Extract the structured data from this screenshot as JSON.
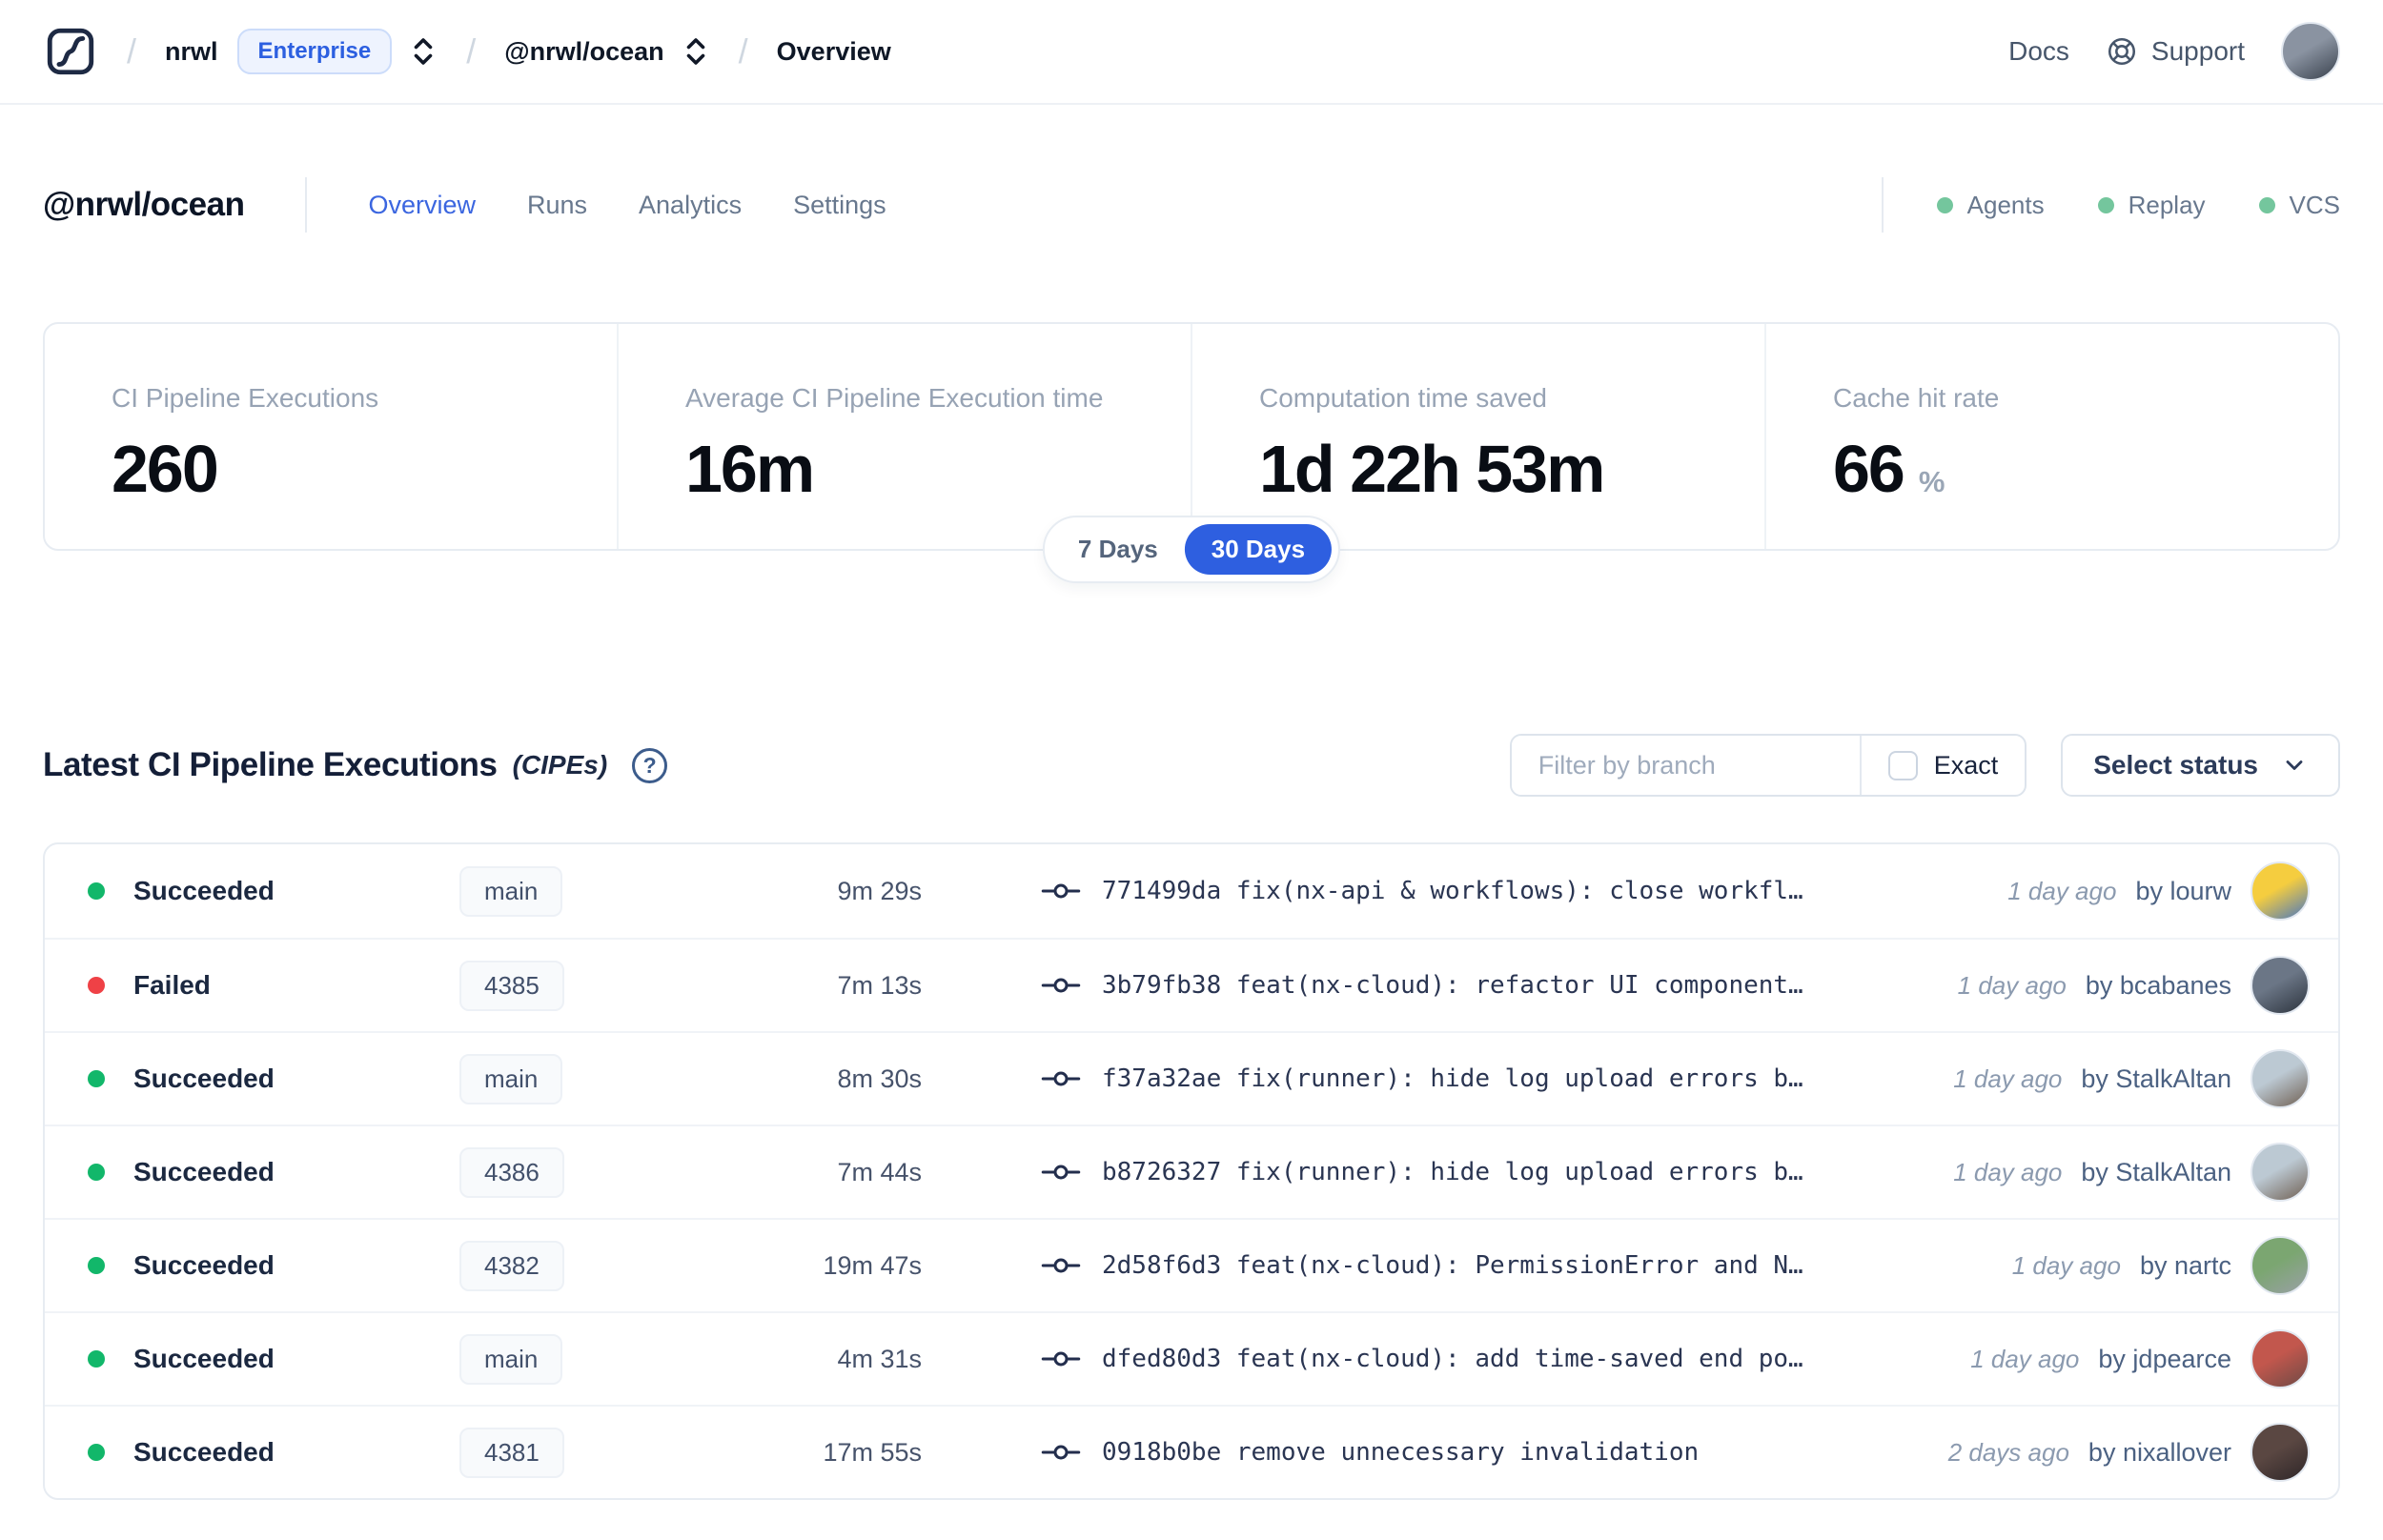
{
  "topbar": {
    "breadcrumb": {
      "org": "nrwl",
      "org_badge": "Enterprise",
      "workspace": "@nrwl/ocean",
      "page": "Overview"
    },
    "docs_label": "Docs",
    "support_label": "Support"
  },
  "workspace_header": {
    "title": "@nrwl/ocean",
    "tabs": [
      {
        "label": "Overview"
      },
      {
        "label": "Runs"
      },
      {
        "label": "Analytics"
      },
      {
        "label": "Settings"
      }
    ],
    "status_dot_color": "#74c69d",
    "statuses": [
      {
        "label": "Agents"
      },
      {
        "label": "Replay"
      },
      {
        "label": "VCS"
      }
    ]
  },
  "stats": {
    "cards": [
      {
        "label": "CI Pipeline Executions",
        "value": "260",
        "suffix": ""
      },
      {
        "label": "Average CI Pipeline Execution time",
        "value": "16m",
        "suffix": ""
      },
      {
        "label": "Computation time saved",
        "value": "1d 22h 53m",
        "suffix": ""
      },
      {
        "label": "Cache hit rate",
        "value": "66",
        "suffix": "%"
      }
    ],
    "range_toggle": {
      "options": [
        "7 Days",
        "30 Days"
      ],
      "selected": "30 Days"
    }
  },
  "cipe_section": {
    "title": "Latest CI Pipeline Executions",
    "title_suffix": "(CIPEs)",
    "help_glyph": "?",
    "filter": {
      "placeholder": "Filter by branch",
      "exact_label": "Exact"
    },
    "status_select_label": "Select status",
    "rows": [
      {
        "status": "Succeeded",
        "dot_color": "#12b76a",
        "branch": "main",
        "duration": "9m 29s",
        "commit_hash": "771499da",
        "commit_message": "fix(nx-api & workflows): close workfl…",
        "time": "1 day ago",
        "author": "by lourw",
        "avatar_colors": [
          "#f5cd3f",
          "#4a77c0"
        ]
      },
      {
        "status": "Failed",
        "dot_color": "#ef4146",
        "branch": "4385",
        "duration": "7m 13s",
        "commit_hash": "3b79fb38",
        "commit_message": "feat(nx-cloud): refactor UI component…",
        "time": "1 day ago",
        "author": "by bcabanes",
        "avatar_colors": [
          "#6b7686",
          "#2c333d"
        ]
      },
      {
        "status": "Succeeded",
        "dot_color": "#12b76a",
        "branch": "main",
        "duration": "8m 30s",
        "commit_hash": "f37a32ae",
        "commit_message": "fix(runner): hide log upload errors b…",
        "time": "1 day ago",
        "author": "by StalkAltan",
        "avatar_colors": [
          "#bcc9d3",
          "#6f5f52"
        ]
      },
      {
        "status": "Succeeded",
        "dot_color": "#12b76a",
        "branch": "4386",
        "duration": "7m 44s",
        "commit_hash": "b8726327",
        "commit_message": "fix(runner): hide log upload errors b…",
        "time": "1 day ago",
        "author": "by StalkAltan",
        "avatar_colors": [
          "#bcc9d3",
          "#6f5f52"
        ]
      },
      {
        "status": "Succeeded",
        "dot_color": "#12b76a",
        "branch": "4382",
        "duration": "19m 47s",
        "commit_hash": "2d58f6d3",
        "commit_message": "feat(nx-cloud): PermissionError and N…",
        "time": "1 day ago",
        "author": "by nartc",
        "avatar_colors": [
          "#7ba671",
          "#9aa0a6"
        ]
      },
      {
        "status": "Succeeded",
        "dot_color": "#12b76a",
        "branch": "main",
        "duration": "4m 31s",
        "commit_hash": "dfed80d3",
        "commit_message": "feat(nx-cloud): add time-saved end po…",
        "time": "1 day ago",
        "author": "by jdpearce",
        "avatar_colors": [
          "#c2574d",
          "#6e4a45"
        ]
      },
      {
        "status": "Succeeded",
        "dot_color": "#12b76a",
        "branch": "4381",
        "duration": "17m 55s",
        "commit_hash": "0918b0be",
        "commit_message": "remove unnecessary invalidation",
        "time": "2 days ago",
        "author": "by nixallover",
        "avatar_colors": [
          "#5a4742",
          "#2e2628"
        ]
      }
    ]
  },
  "topbar_avatar_colors": [
    "#8a93a1",
    "#39414d"
  ]
}
